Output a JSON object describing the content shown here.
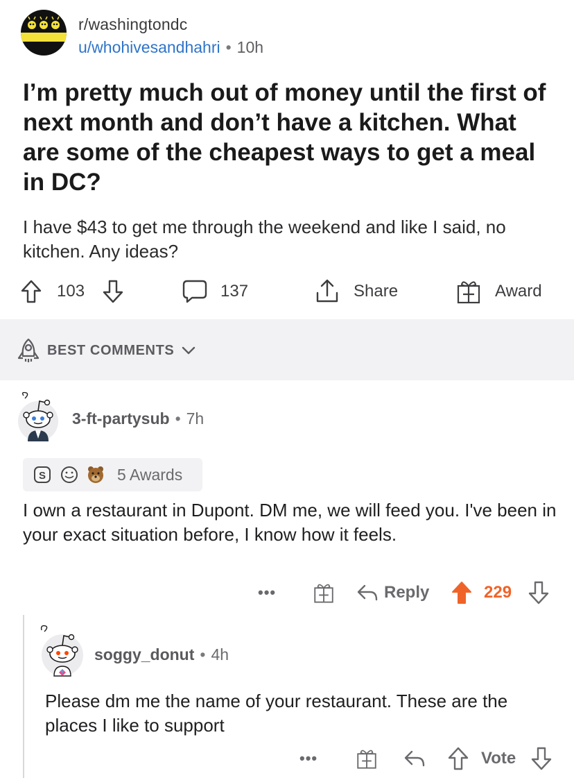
{
  "post": {
    "subreddit": "r/washingtondc",
    "author": "u/whohivesandhahri",
    "separator": "•",
    "age": "10h",
    "title": "I’m pretty much out of money until the first of next month and don’t have a kitchen. What are some of the cheapest ways to get a meal in DC?",
    "body": "I have $43 to get me through the weekend and like I said, no kitchen. Any ideas?",
    "votes": "103",
    "comments": "137",
    "share_label": "Share",
    "award_label": "Award"
  },
  "sort": {
    "label": "BEST COMMENTS"
  },
  "comments": [
    {
      "author": "3-ft-partysub",
      "separator": "•",
      "age": "7h",
      "awards_label": "5 Awards",
      "text": "I own a restaurant in Dupont. DM me, we will feed you. I've been in your exact situation before, I know how it feels.",
      "more": "•••",
      "reply_label": "Reply",
      "score": "229"
    },
    {
      "author": "soggy_donut",
      "separator": "•",
      "age": "4h",
      "text": "Please dm me the name of your restaurant. These are the places I like to support",
      "more": "•••",
      "vote_label": "Vote"
    }
  ],
  "colors": {
    "link": "#2e74c9",
    "upvote_active": "#f06328",
    "band": "#f2f2f4"
  }
}
